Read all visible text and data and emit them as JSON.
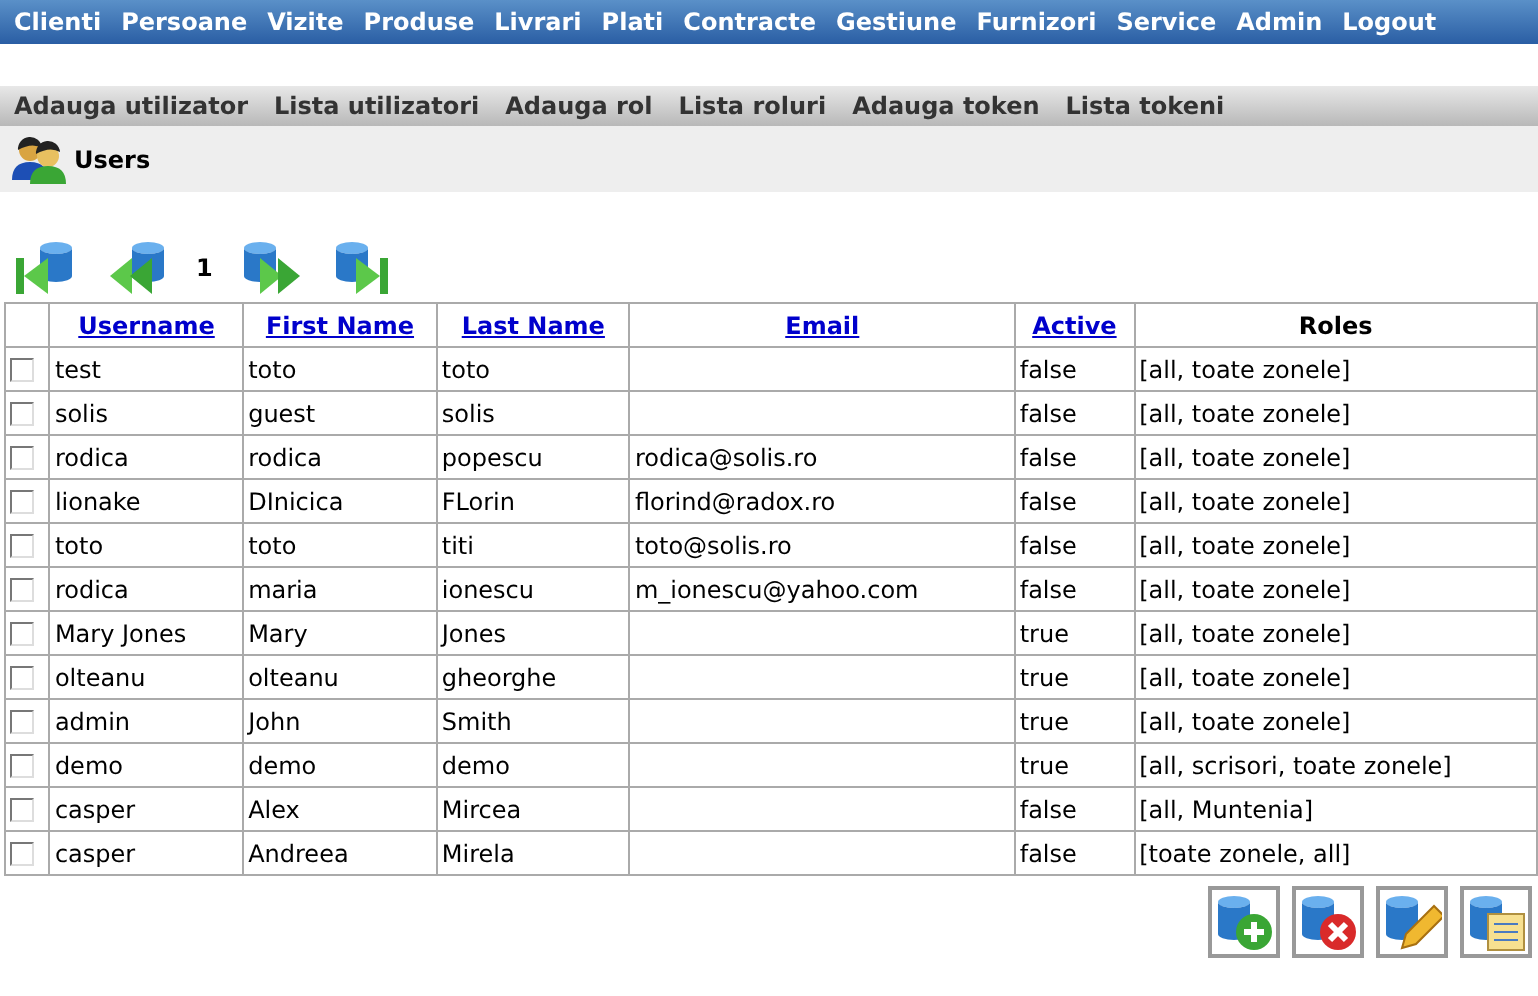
{
  "main_menu": [
    "Clienti",
    "Persoane",
    "Vizite",
    "Produse",
    "Livrari",
    "Plati",
    "Contracte",
    "Gestiune",
    "Furnizori",
    "Service",
    "Admin",
    "Logout"
  ],
  "sub_menu": [
    "Adauga utilizator",
    "Lista utilizatori",
    "Adauga rol",
    "Lista roluri",
    "Adauga token",
    "Lista tokeni"
  ],
  "page_title": "Users",
  "pager": {
    "page": "1"
  },
  "table": {
    "columns": [
      {
        "label": "Username",
        "kind": "link"
      },
      {
        "label": "First Name",
        "kind": "link"
      },
      {
        "label": "Last Name",
        "kind": "link"
      },
      {
        "label": "Email",
        "kind": "link"
      },
      {
        "label": "Active",
        "kind": "link"
      },
      {
        "label": "Roles",
        "kind": "plain"
      }
    ],
    "rows": [
      {
        "checked": false,
        "cells": [
          "test",
          "toto",
          "toto",
          "",
          "false",
          "[all, toate zonele]"
        ]
      },
      {
        "checked": false,
        "cells": [
          "solis",
          "guest",
          "solis",
          "",
          "false",
          "[all, toate zonele]"
        ]
      },
      {
        "checked": false,
        "cells": [
          "rodica",
          "rodica",
          "popescu",
          "rodica@solis.ro",
          "false",
          "[all, toate zonele]"
        ]
      },
      {
        "checked": false,
        "cells": [
          "lionake",
          "DInicica",
          "FLorin",
          "florind@radox.ro",
          "false",
          "[all, toate zonele]"
        ]
      },
      {
        "checked": false,
        "cells": [
          "toto",
          "toto",
          "titi",
          "toto@solis.ro",
          "false",
          "[all, toate zonele]"
        ]
      },
      {
        "checked": false,
        "cells": [
          "rodica",
          "maria",
          "ionescu",
          "m_ionescu@yahoo.com",
          "false",
          "[all, toate zonele]"
        ]
      },
      {
        "checked": false,
        "cells": [
          "Mary Jones",
          "Mary",
          "Jones",
          "",
          "true",
          "[all, toate zonele]"
        ]
      },
      {
        "checked": false,
        "cells": [
          "olteanu",
          "olteanu",
          "gheorghe",
          "",
          "true",
          "[all, toate zonele]"
        ]
      },
      {
        "checked": false,
        "cells": [
          "admin",
          "John",
          "Smith",
          "",
          "true",
          "[all, toate zonele]"
        ]
      },
      {
        "checked": false,
        "cells": [
          "demo",
          "demo",
          "demo",
          "",
          "true",
          "[all, scrisori, toate zonele]"
        ]
      },
      {
        "checked": false,
        "cells": [
          "casper",
          "Alex",
          "Mircea",
          "",
          "false",
          "[all, Muntenia]"
        ]
      },
      {
        "checked": false,
        "cells": [
          "casper",
          "Andreea",
          "Mirela",
          "",
          "false",
          "[toate zonele, all]"
        ]
      }
    ]
  },
  "actions": [
    {
      "kind": "add"
    },
    {
      "kind": "delete"
    },
    {
      "kind": "edit"
    },
    {
      "kind": "list"
    }
  ]
}
